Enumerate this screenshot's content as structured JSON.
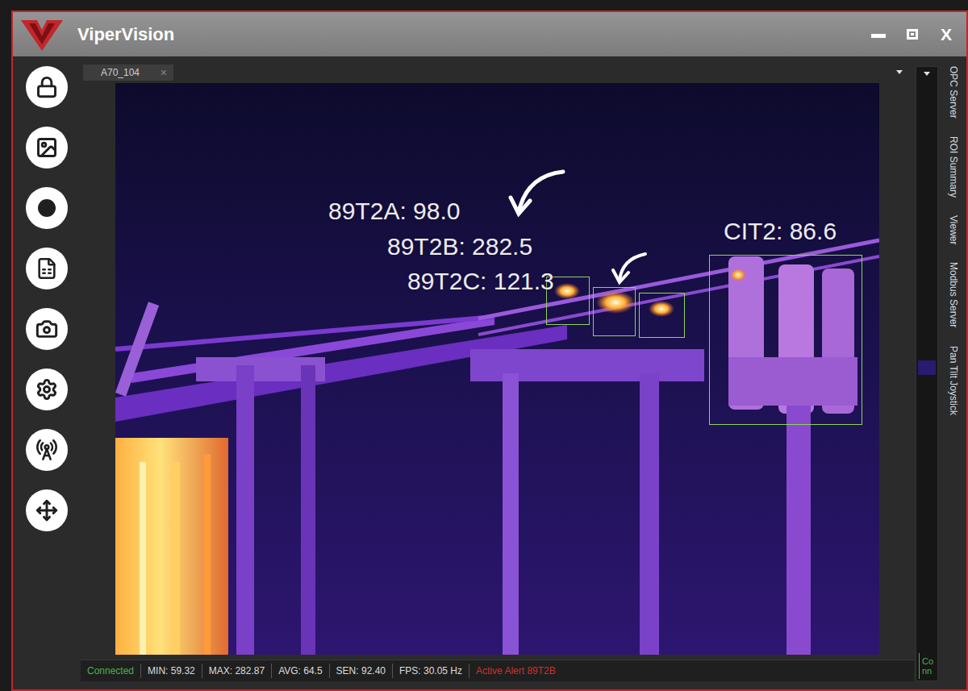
{
  "window": {
    "title": "ViperVision",
    "close": "X"
  },
  "tabs": [
    {
      "label": "A70_104",
      "close": "×",
      "selected": true
    }
  ],
  "rois": [
    {
      "label": "89T2A: 98.0"
    },
    {
      "label": "89T2B: 282.5"
    },
    {
      "label": "89T2C: 121.3"
    },
    {
      "label": "CIT2: 86.6"
    }
  ],
  "side_tabs": [
    "OPC Server",
    "ROI Summary",
    "Viewer",
    "Modbus Server",
    "Pan Tilt Joystick"
  ],
  "status_bar": {
    "connection": "Connected",
    "readings": [
      "MIN: 59.32",
      "MAX: 282.87",
      "AVG: 64.5",
      "SEN: 92.40",
      "FPS: 30.05 Hz"
    ],
    "alert": "Active Alert 89T2B"
  },
  "connection_badge": "Conn"
}
